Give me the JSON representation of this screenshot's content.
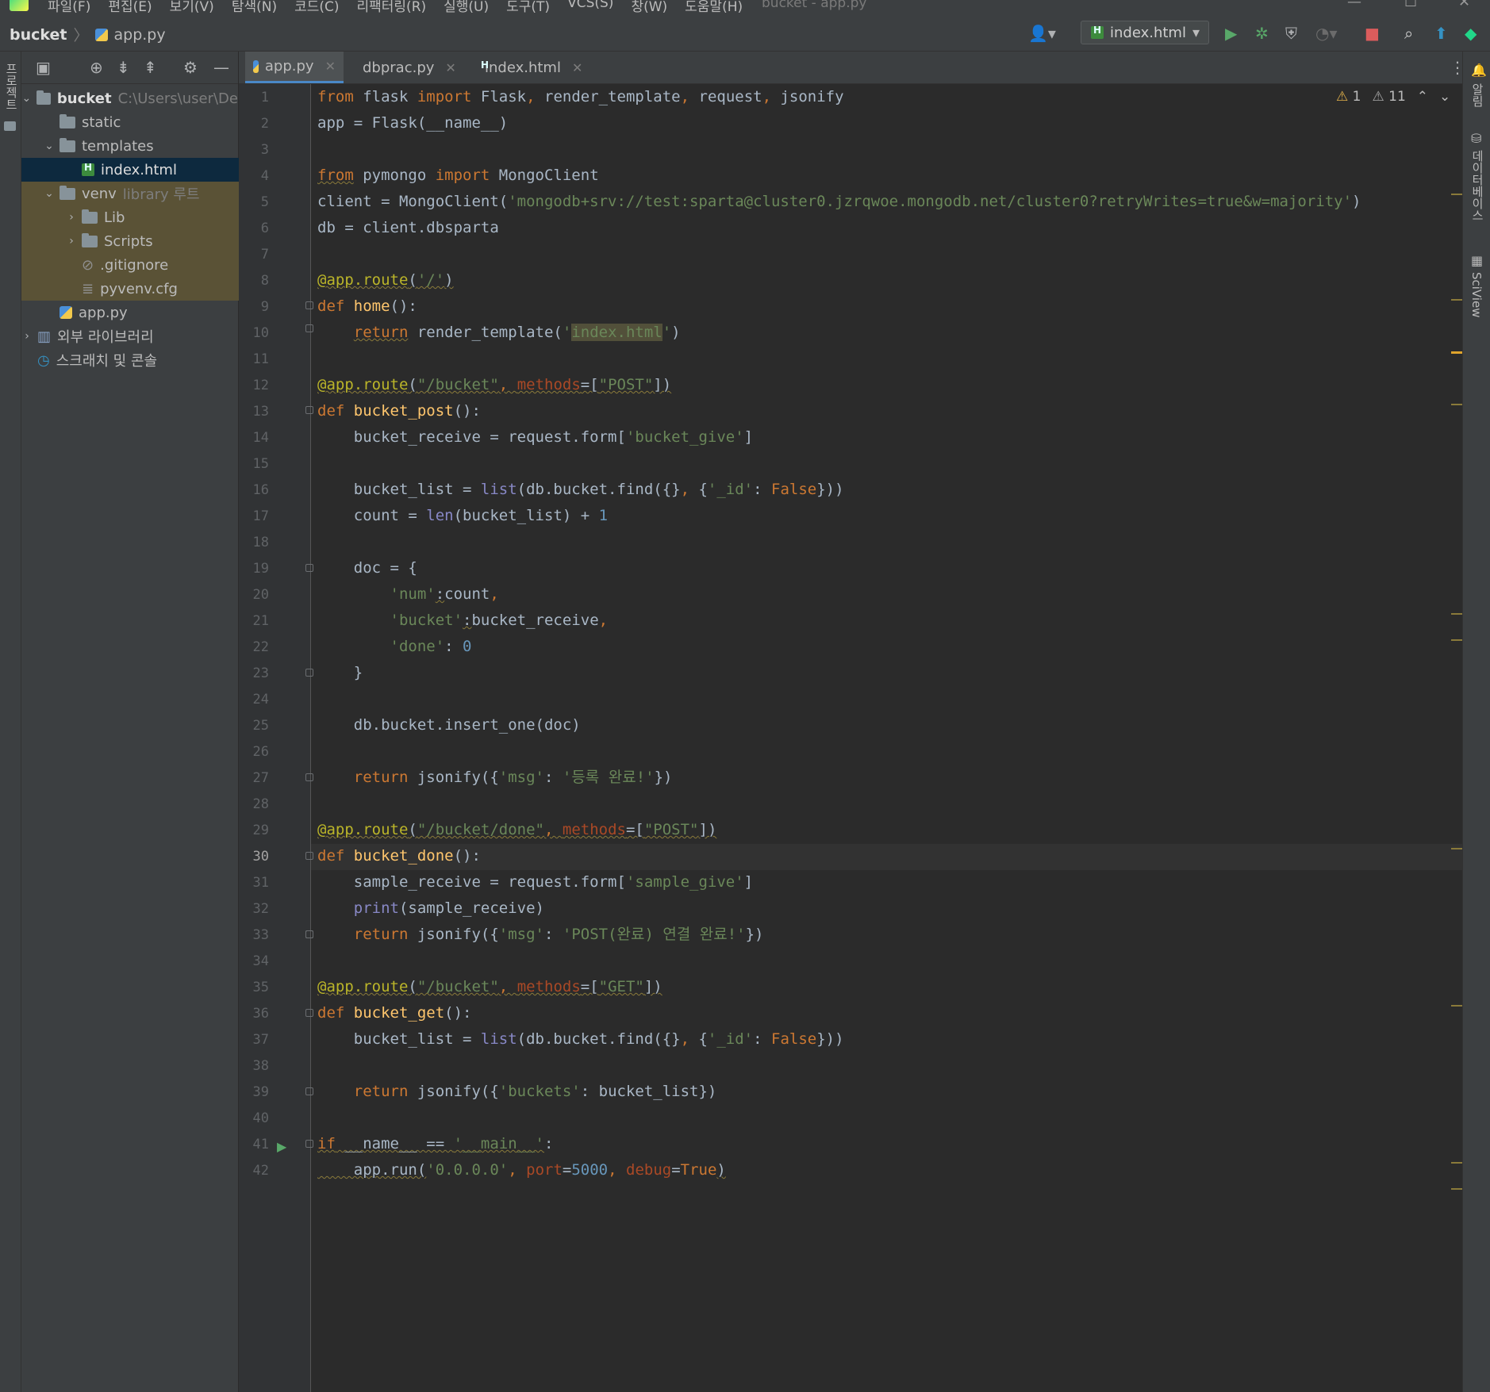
{
  "menubar": {
    "items": [
      "파일(F)",
      "편집(E)",
      "보기(V)",
      "탐색(N)",
      "코드(C)",
      "리팩터링(R)",
      "실행(U)",
      "도구(T)",
      "VCS(S)",
      "창(W)",
      "도움말(H)"
    ],
    "window_title": "bucket - app.py"
  },
  "navbar": {
    "project": "bucket",
    "file": "app.py",
    "run_config": "index.html"
  },
  "left_strip": {
    "project_label": "프로젝트"
  },
  "right_strip": {
    "notifications": "알림",
    "database": "데이터베이스",
    "sciview": "SciView"
  },
  "tree": {
    "root": {
      "name": "bucket",
      "path": "C:\\Users\\user\\De"
    },
    "static": "static",
    "templates": "templates",
    "index_html": "index.html",
    "venv": {
      "name": "venv",
      "tag": "library 루트"
    },
    "lib": "Lib",
    "scripts": "Scripts",
    "gitignore": ".gitignore",
    "pyvenv": "pyvenv.cfg",
    "app_py": "app.py",
    "external_libs": "외부 라이브러리",
    "scratches": "스크래치 및 콘솔"
  },
  "tabs": [
    "app.py",
    "dbprac.py",
    "index.html"
  ],
  "inspections": {
    "warnings": "1",
    "weak_warnings": "11"
  },
  "editor": {
    "current_line": 30,
    "line_numbers": [
      "1",
      "2",
      "3",
      "4",
      "5",
      "6",
      "7",
      "8",
      "9",
      "10",
      "11",
      "12",
      "13",
      "14",
      "15",
      "16",
      "17",
      "18",
      "19",
      "20",
      "21",
      "22",
      "23",
      "24",
      "25",
      "26",
      "27",
      "28",
      "29",
      "30",
      "31",
      "32",
      "33",
      "34",
      "35",
      "36",
      "37",
      "38",
      "39",
      "40",
      "41",
      "42"
    ],
    "code": {
      "l1": [
        "from",
        " flask ",
        "import",
        " Flask",
        ",",
        " render_template",
        ",",
        " request",
        ",",
        " jsonify"
      ],
      "l2": "app = Flask(__name__)",
      "l4": [
        "from",
        " pymongo ",
        "import",
        " MongoClient"
      ],
      "l5": [
        "client = MongoClient(",
        "'mongodb+srv://test:sparta@cluster0.jzrqwoe.mongodb.net/cluster0?retryWrites=true&w=majority'",
        ")"
      ],
      "l6": "db = client.dbsparta",
      "l8": [
        "@app.route",
        "(",
        "'/'",
        ")"
      ],
      "l9": [
        "def ",
        "home",
        "():"
      ],
      "l10": [
        "    ",
        "return",
        " render_template(",
        "'",
        "index.html",
        "'",
        ")"
      ],
      "l12": [
        "@app.route",
        "(",
        "\"/bucket\"",
        ", ",
        "methods",
        "=[",
        "\"POST\"",
        "])"
      ],
      "l13": [
        "def ",
        "bucket_post",
        "():"
      ],
      "l14": [
        "    bucket_receive = request.form[",
        "'bucket_give'",
        "]"
      ],
      "l16": [
        "    bucket_list = ",
        "list",
        "(db.bucket.find({}",
        ", ",
        "{",
        "'_id'",
        ": ",
        "False",
        "}))"
      ],
      "l17": [
        "    count = ",
        "len",
        "(bucket_list) + ",
        "1"
      ],
      "l19": "    doc = {",
      "l20": [
        "        ",
        "'num'",
        ":",
        "count",
        ","
      ],
      "l21": [
        "        ",
        "'bucket'",
        ":",
        "bucket_receive",
        ","
      ],
      "l22": [
        "        ",
        "'done'",
        ": ",
        "0"
      ],
      "l23": "    }",
      "l25": "    db.bucket.insert_one(doc)",
      "l27": [
        "    ",
        "return",
        " jsonify({",
        "'msg'",
        ": ",
        "'등록 완료!'",
        "})"
      ],
      "l29": [
        "@app.route",
        "(",
        "\"/bucket/done\"",
        ", ",
        "methods",
        "=[",
        "\"POST\"",
        "])"
      ],
      "l30": [
        "def ",
        "bucket_done",
        "():"
      ],
      "l31": [
        "    sample_receive = request.form[",
        "'sample_give'",
        "]"
      ],
      "l32": [
        "    ",
        "print",
        "(sample_receive)"
      ],
      "l33": [
        "    ",
        "return",
        " jsonify({",
        "'msg'",
        ": ",
        "'POST(완료) 연결 완료!'",
        "})"
      ],
      "l35": [
        "@app.route",
        "(",
        "\"/bucket\"",
        ", ",
        "methods",
        "=[",
        "\"GET\"",
        "])"
      ],
      "l36": [
        "def ",
        "bucket_get",
        "():"
      ],
      "l37": [
        "    bucket_list = ",
        "list",
        "(db.bucket.find({}",
        ", ",
        "{",
        "'_id'",
        ": ",
        "False",
        "}))"
      ],
      "l39": [
        "    ",
        "return",
        " jsonify({",
        "'buckets'",
        ": bucket_list})"
      ],
      "l41": [
        "if",
        " __name__ == ",
        "'__main__'",
        ":"
      ],
      "l42": [
        "    app.run(",
        "'0.0.0.0'",
        ", ",
        "port",
        "=",
        "5000",
        ", ",
        "debug",
        "=",
        "True",
        ")"
      ]
    }
  },
  "colors": {
    "background": "#2b2b2b",
    "keyword": "#cc7832",
    "function": "#ffc66d",
    "string": "#6a8759",
    "number": "#6897bb",
    "decorator": "#bbb529",
    "builtin": "#8888c6",
    "parameter": "#aa4926"
  },
  "icons": {
    "run": "play-icon",
    "debug": "bug-icon",
    "coverage": "shield-run-icon",
    "stop": "stop-icon",
    "search": "search-icon",
    "update": "arrow-up-icon"
  }
}
